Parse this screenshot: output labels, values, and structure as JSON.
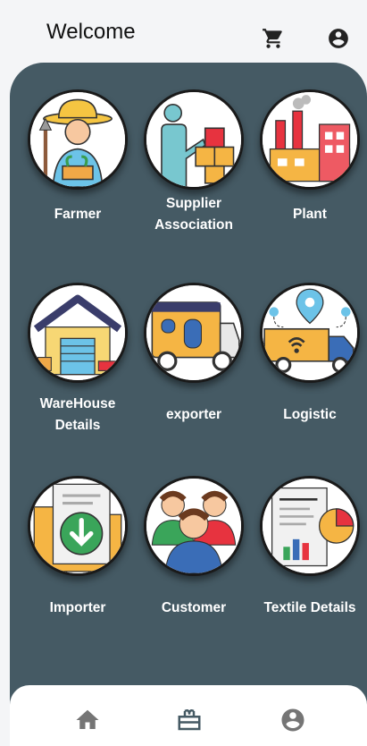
{
  "header": {
    "title": "Welcome",
    "cart_icon": "cart-icon",
    "account_icon": "account-circle-icon"
  },
  "colors": {
    "panel": "#455a64",
    "nav_active": "#455a64",
    "nav_inactive": "#757575",
    "label": "#ffffff"
  },
  "tiles": [
    {
      "label": "Farmer",
      "icon": "farmer-icon"
    },
    {
      "label": "Supplier\nAssociation",
      "icon": "supplier-association-icon"
    },
    {
      "label": "Plant",
      "icon": "plant-factory-icon"
    },
    {
      "label": "WareHouse\nDetails",
      "icon": "warehouse-icon"
    },
    {
      "label": "exporter",
      "icon": "exporter-truck-icon"
    },
    {
      "label": "Logistic",
      "icon": "logistic-truck-icon"
    },
    {
      "label": "Importer",
      "icon": "importer-folder-icon"
    },
    {
      "label": "Customer",
      "icon": "customer-group-icon"
    },
    {
      "label": "Textile Details",
      "icon": "textile-report-icon"
    }
  ],
  "bottom_nav": [
    {
      "icon": "home-icon",
      "active": false
    },
    {
      "icon": "dashboard-icon",
      "active": true
    },
    {
      "icon": "profile-icon",
      "active": false
    }
  ]
}
